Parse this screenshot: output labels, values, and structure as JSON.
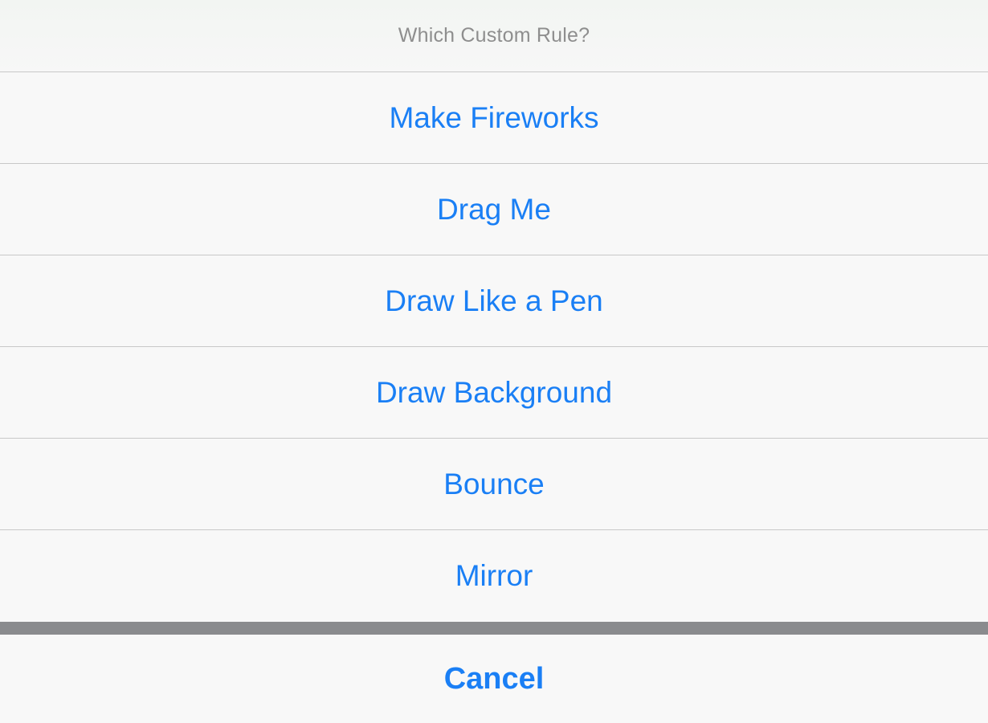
{
  "action_sheet": {
    "title": "Which Custom Rule?",
    "options": [
      {
        "label": "Make Fireworks"
      },
      {
        "label": "Drag Me"
      },
      {
        "label": "Draw Like a Pen"
      },
      {
        "label": "Draw Background"
      },
      {
        "label": "Bounce"
      },
      {
        "label": "Mirror"
      }
    ],
    "cancel_label": "Cancel"
  },
  "colors": {
    "accent": "#1a7ff5",
    "title_gray": "#8e8e8e",
    "separator": "#8a8b8e",
    "background": "#f7f7f7"
  }
}
